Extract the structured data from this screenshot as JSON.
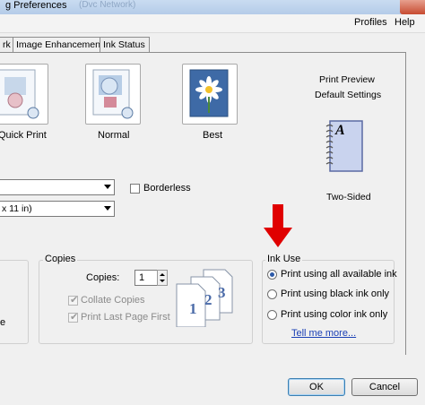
{
  "window": {
    "title": "g Preferences",
    "title_faint": "(Dvc Network)"
  },
  "menu": {
    "profiles": "Profiles",
    "help": "Help"
  },
  "tabs": [
    "rk",
    "Image Enhancement",
    "Ink Status"
  ],
  "quality": {
    "options": [
      {
        "label": "Quick Print"
      },
      {
        "label": "Normal"
      },
      {
        "label": "Best"
      }
    ]
  },
  "preview": {
    "line1": "Print Preview",
    "line2": "Default Settings",
    "book_letter": "A",
    "two_sided": "Two-Sided"
  },
  "paper": {
    "type_value": "",
    "size_value": "x 11 in)",
    "borderless_label": "Borderless"
  },
  "left_group": {
    "partial_text": "e"
  },
  "copies": {
    "group_label": "Copies",
    "copies_label": "Copies:",
    "copies_value": "1",
    "collate_label": "Collate Copies",
    "last_first_label": "Print Last Page First",
    "stack_numbers": [
      "1",
      "2",
      "3"
    ]
  },
  "ink_use": {
    "group_label": "Ink Use",
    "options": [
      {
        "label": "Print using all available ink",
        "checked": true
      },
      {
        "label": "Print using black ink only",
        "checked": false
      },
      {
        "label": "Print using color ink only",
        "checked": false
      }
    ],
    "tell_more": "Tell me more..."
  },
  "buttons": {
    "ok": "OK",
    "cancel": "Cancel"
  },
  "colors": {
    "annotation_arrow": "#e00000",
    "link": "#1a3fb5"
  }
}
